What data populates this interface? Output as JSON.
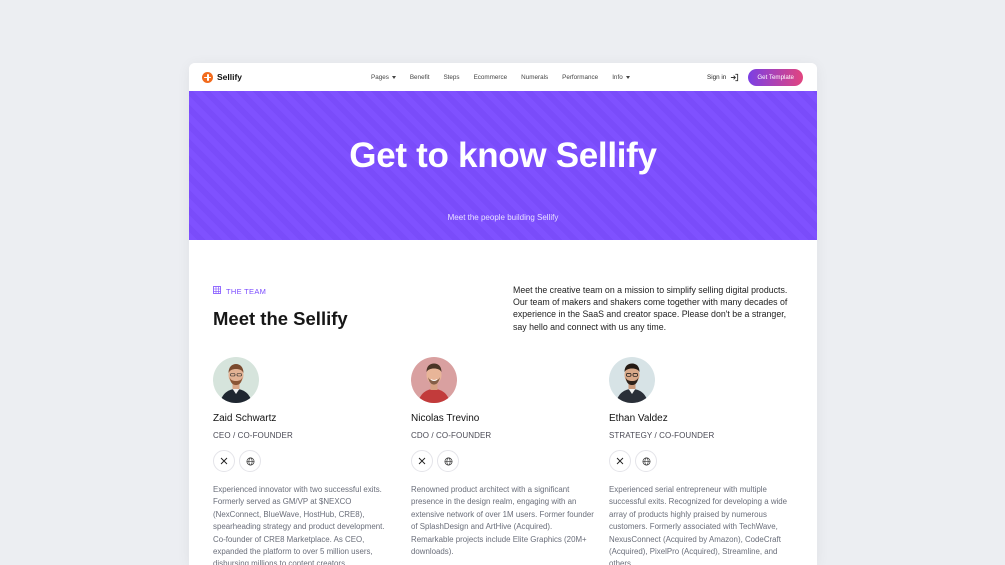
{
  "nav": {
    "brand": "Sellify",
    "items": [
      {
        "label": "Pages",
        "dropdown": true
      },
      {
        "label": "Benefit",
        "dropdown": false
      },
      {
        "label": "Steps",
        "dropdown": false
      },
      {
        "label": "Ecommerce",
        "dropdown": false
      },
      {
        "label": "Numerals",
        "dropdown": false
      },
      {
        "label": "Performance",
        "dropdown": false
      },
      {
        "label": "Info",
        "dropdown": true
      }
    ],
    "signin": "Sign in",
    "cta": "Get Template"
  },
  "hero": {
    "title": "Get to know Sellify",
    "subtitle": "Meet the people building Sellify"
  },
  "team": {
    "eyebrow": "THE TEAM",
    "title": "Meet the Sellify",
    "intro": "Meet the creative team on a mission to simplify selling digital products. Our team of makers and shakers come together with many decades of experience in the SaaS and creator space. Please don't be a stranger, say hello and connect with us any time.",
    "members": [
      {
        "name": "Zaid Schwartz",
        "role": "CEO / CO-FOUNDER",
        "bio": "Experienced innovator with two successful exits. Formerly served as GM/VP at $NEXCO (NexConnect, BlueWave, HostHub, CRE8), spearheading strategy and product development. Co-founder of CRE8 Marketplace. As CEO, expanded the platform to over 5 million users, disbursing millions to content creators."
      },
      {
        "name": "Nicolas Trevino",
        "role": "CDO / CO-FOUNDER",
        "bio": "Renowned product architect with a significant presence in the design realm, engaging with an extensive network of over 1M users. Former founder of SplashDesign and ArtHive (Acquired). Remarkable projects include Elite Graphics (20M+ downloads)."
      },
      {
        "name": "Ethan Valdez",
        "role": "STRATEGY / CO-FOUNDER",
        "bio": "Experienced serial entrepreneur with multiple successful exits. Recognized for developing a wide array of products highly praised by numerous customers. Formerly associated with TechWave, NexusConnect (Acquired by Amazon), CodeCraft (Acquired), PixelPro (Acquired), Streamline, and others."
      }
    ]
  },
  "colors": {
    "hero_bg": "#7c4dff",
    "accent": "#7c4dff",
    "brand_logo": "#f26b1d",
    "cta_gradient": [
      "#7b3fe4",
      "#e2457f"
    ]
  }
}
